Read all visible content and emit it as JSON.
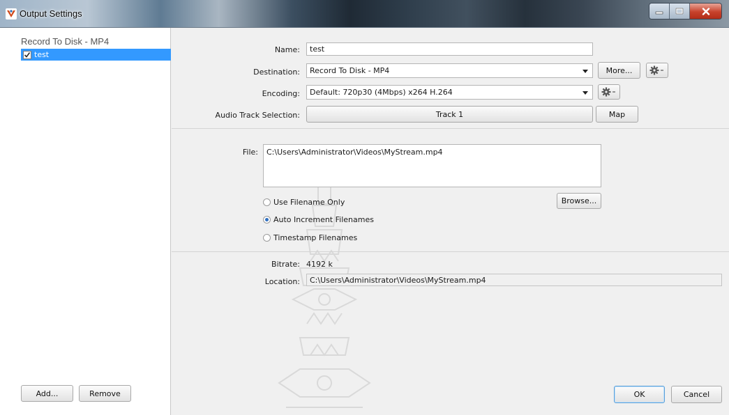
{
  "window": {
    "title": "Output Settings"
  },
  "sidebar": {
    "group_header": "Record To Disk - MP4",
    "items": [
      {
        "label": "test",
        "checked": true,
        "selected": true
      }
    ],
    "add_label": "Add...",
    "remove_label": "Remove"
  },
  "form": {
    "name_label": "Name:",
    "name_value": "test",
    "destination_label": "Destination:",
    "destination_value": "Record To Disk - MP4",
    "more_label": "More...",
    "encoding_label": "Encoding:",
    "encoding_value": "Default: 720p30 (4Mbps) x264 H.264",
    "audio_track_label": "Audio Track Selection:",
    "audio_track_value": "Track 1",
    "map_label": "Map"
  },
  "file_section": {
    "file_label": "File:",
    "file_value": "C:\\Users\\Administrator\\Videos\\MyStream.mp4",
    "browse_label": "Browse...",
    "radios": [
      {
        "label": "Use Filename Only",
        "selected": false
      },
      {
        "label": "Auto Increment Filenames",
        "selected": true
      },
      {
        "label": "Timestamp Filenames",
        "selected": false
      }
    ]
  },
  "info": {
    "bitrate_label": "Bitrate:",
    "bitrate_value": "4192 k",
    "location_label": "Location:",
    "location_value": "C:\\Users\\Administrator\\Videos\\MyStream.mp4"
  },
  "footer": {
    "ok_label": "OK",
    "cancel_label": "Cancel"
  },
  "colors": {
    "selection": "#3399ff",
    "window_bg": "#f0f0f0",
    "close_button": "#c7422c"
  },
  "icons": {
    "app": "vmix-v-icon",
    "settings": "gear-icon",
    "dropdown": "chevron-down-icon"
  }
}
